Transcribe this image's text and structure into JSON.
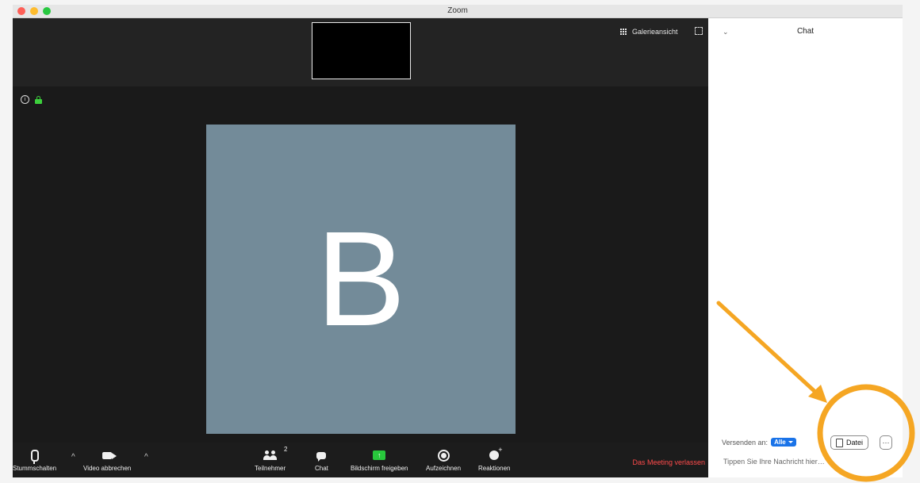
{
  "window": {
    "title": "Zoom"
  },
  "video": {
    "gallery_view_label": "Galerieansicht",
    "speaker_initial": "B",
    "speaker_color": "#738b99"
  },
  "toolbar": {
    "mute_label": "Stummschalten",
    "video_label": "Video abbrechen",
    "participants_label": "Teilnehmer",
    "participants_count": "2",
    "chat_label": "Chat",
    "share_label": "Bildschirm freigeben",
    "record_label": "Aufzeichnen",
    "reactions_label": "Reaktionen",
    "leave_label": "Das Meeting verlassen",
    "leave_color": "#ff4b4b",
    "share_color": "#28c73c"
  },
  "chat": {
    "title": "Chat",
    "send_to_label": "Versenden an:",
    "recipient": "Alle",
    "file_button_label": "Datei",
    "more_button_label": "···",
    "message_placeholder": "Tippen Sie Ihre Nachricht hier…",
    "accent_color": "#1a73e8"
  },
  "annotation": {
    "color": "#f5a623"
  }
}
